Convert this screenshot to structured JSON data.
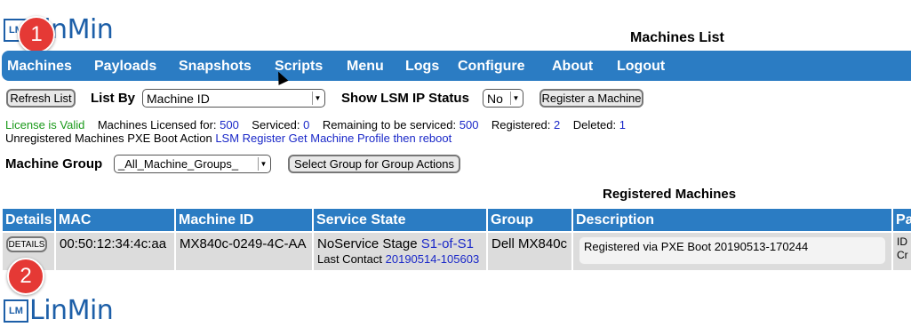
{
  "logo": {
    "mark": "LM",
    "text": "LinMin"
  },
  "badges": [
    "1",
    "2"
  ],
  "page_title": "Machines List",
  "nav": [
    "Machines",
    "Payloads",
    "Snapshots",
    "Scripts",
    "Menu",
    "Logs",
    "Configure",
    "About",
    "Logout"
  ],
  "toolbar": {
    "refresh_label": "Refresh List",
    "list_by_label": "List By",
    "list_by_value": "Machine ID",
    "lsm_label": "Show LSM IP Status",
    "lsm_value": "No",
    "register_label": "Register a Machine"
  },
  "license": {
    "valid": "License is Valid",
    "licensed_label": "Machines Licensed for:",
    "licensed": "500",
    "serviced_label": "Serviced:",
    "serviced": "0",
    "remaining_label": "Remaining to be serviced:",
    "remaining": "500",
    "registered_label": "Registered:",
    "registered": "2",
    "deleted_label": "Deleted:",
    "deleted": "1",
    "pxe_label": "Unregistered Machines PXE Boot Action",
    "pxe_action": "LSM Register Get Machine Profile then reboot"
  },
  "group": {
    "label": "Machine Group",
    "value": "_All_Machine_Groups_",
    "action_label": "Select Group for Group Actions"
  },
  "table": {
    "title": "Registered Machines",
    "headers": [
      "Details",
      "MAC",
      "Machine ID",
      "Service State",
      "Group",
      "Description",
      "Pa"
    ],
    "row": {
      "details": "DETAILS",
      "mac": "00:50:12:34:4c:aa",
      "machine_id": "MX840c-0249-4C-AA",
      "state": "NoService Stage",
      "stage": "S1-of-S1",
      "contact_label": "Last Contact",
      "contact": "20190514-105603",
      "group": "Dell MX840c",
      "description": "Registered via PXE Boot 20190513-170244",
      "extra": "ID Cr"
    }
  },
  "colors": {
    "accent": "#2b7cc3",
    "badge": "#e53935",
    "valid": "#1a9a1a",
    "link": "#1a28c8"
  }
}
